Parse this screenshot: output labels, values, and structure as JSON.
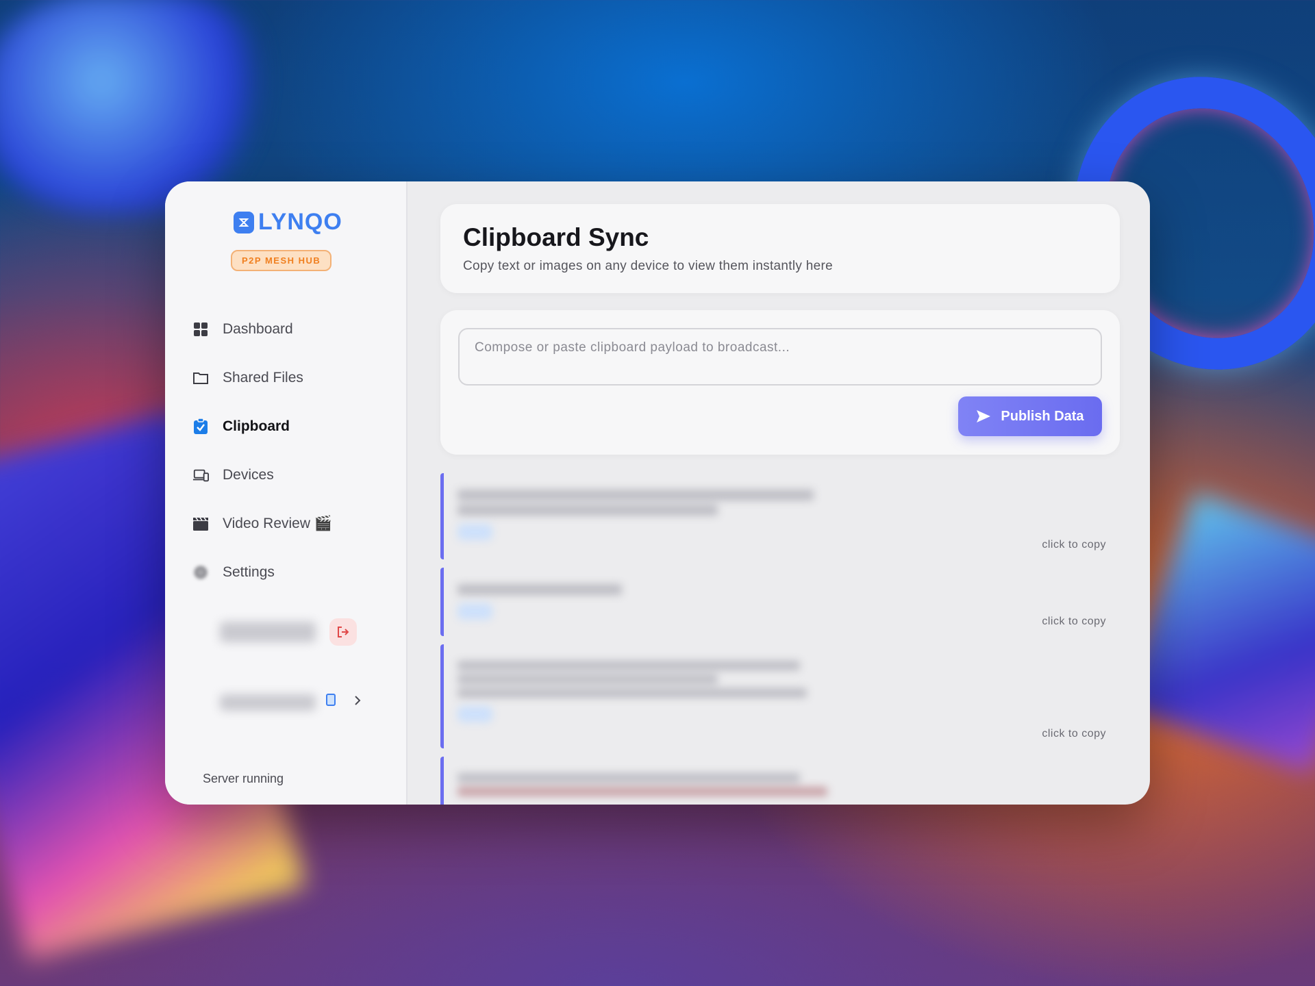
{
  "app": {
    "logo_text": "LYNQO",
    "badge": "P2P MESH HUB"
  },
  "sidebar": {
    "items": [
      {
        "label": "Dashboard",
        "icon": "grid-icon"
      },
      {
        "label": "Shared Files",
        "icon": "folder-icon"
      },
      {
        "label": "Clipboard",
        "icon": "clipboard-check-icon",
        "active": true
      },
      {
        "label": "Devices",
        "icon": "devices-icon"
      },
      {
        "label": "Video Review 🎬",
        "icon": "clapperboard-icon"
      },
      {
        "label": "Settings",
        "icon": "gear-icon"
      }
    ],
    "server_status": "Server running"
  },
  "header": {
    "title": "Clipboard Sync",
    "subtitle": "Copy text or images on any device to view them instantly here"
  },
  "compose": {
    "placeholder": "Compose or paste clipboard payload to broadcast...",
    "publish_label": "Publish Data"
  },
  "clips": [
    {
      "copy_hint": "click to copy"
    },
    {
      "copy_hint": "click to copy"
    },
    {
      "copy_hint": "click to copy"
    }
  ],
  "colors": {
    "accent": "#6b6df0",
    "brand": "#3e7ff0",
    "badge": "#f07f1f",
    "active_icon": "#1c7de8"
  }
}
